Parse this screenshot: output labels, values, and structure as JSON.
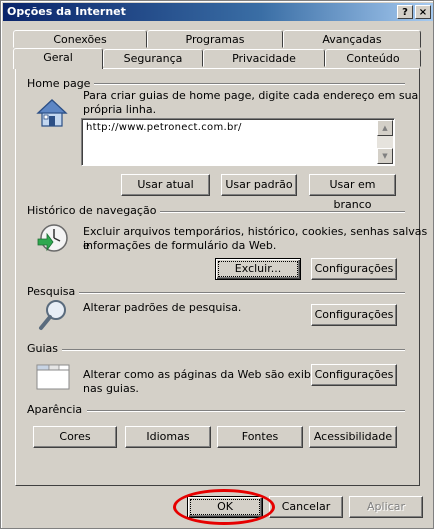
{
  "window": {
    "title": "Opções da Internet",
    "help_glyph": "?",
    "close_glyph": "×"
  },
  "tabs": {
    "back_row": [
      "Conexões",
      "Programas",
      "Avançadas"
    ],
    "front_row": [
      "Geral",
      "Segurança",
      "Privacidade",
      "Conteúdo"
    ],
    "active": "Geral"
  },
  "home_page": {
    "title": "Home page",
    "description_line1": "Para criar guias de home page, digite cada endereço em sua",
    "description_line2": "própria linha.",
    "url_value": "http://www.petronect.com.br/",
    "buttons": {
      "use_current": "Usar atual",
      "use_default": "Usar padrão",
      "use_blank": "Usar em branco"
    },
    "icon": "home-page-icon"
  },
  "history": {
    "title": "Histórico de navegação",
    "description_line1": "Excluir arquivos temporários, histórico, cookies, senhas salvas e",
    "description_line2": "informações de formulário da Web.",
    "buttons": {
      "delete": "Excluir...",
      "settings": "Configurações"
    },
    "icon": "history-clock-icon"
  },
  "search": {
    "title": "Pesquisa",
    "description": "Alterar padrões de pesquisa.",
    "buttons": {
      "settings": "Configurações"
    },
    "icon": "magnifier-icon"
  },
  "tabs_section": {
    "title": "Guias",
    "description_line1": "Alterar como as páginas da Web são exibidas",
    "description_line2": "nas guias.",
    "buttons": {
      "settings": "Configurações"
    },
    "icon": "tabbed-window-icon"
  },
  "appearance": {
    "title": "Aparência",
    "buttons": {
      "colors": "Cores",
      "languages": "Idiomas",
      "fonts": "Fontes",
      "accessibility": "Acessibilidade"
    }
  },
  "footer": {
    "ok": "OK",
    "cancel": "Cancelar",
    "apply": "Aplicar"
  },
  "colors": {
    "title_bar_start": "#0a246a",
    "title_bar_end": "#a6caf0",
    "annotation": "#e60000",
    "face": "#d4d0c8"
  }
}
